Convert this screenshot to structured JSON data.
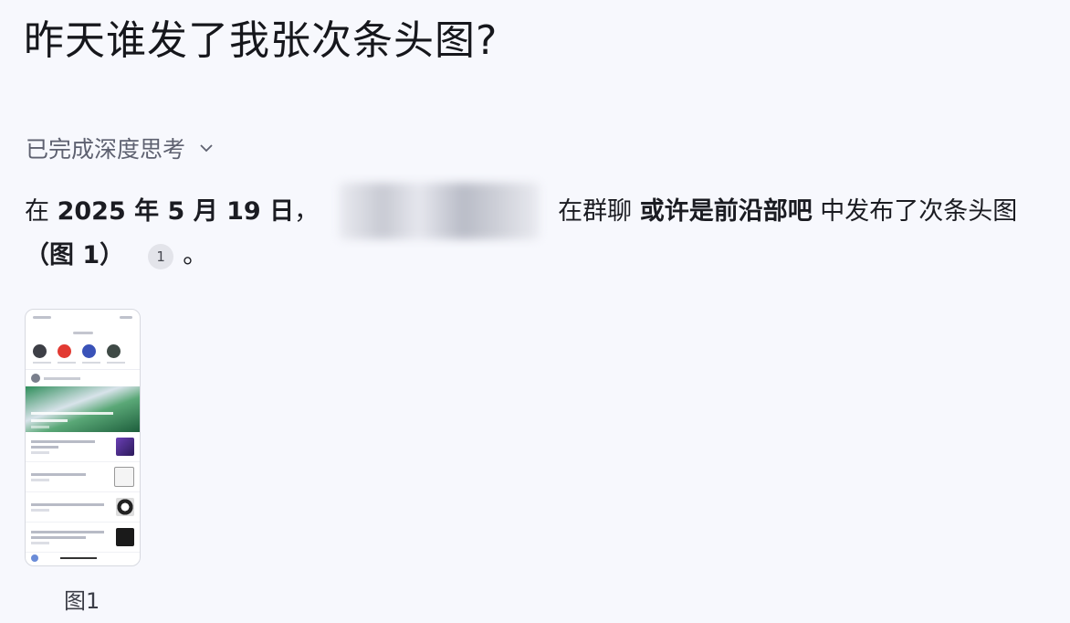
{
  "question": "昨天谁发了我张次条头图?",
  "thinking": {
    "label": "已完成深度思考"
  },
  "answer": {
    "p1": "在 ",
    "date": "2025 年 5 月 19 日",
    "p2": "，",
    "p3": "在群聊 ",
    "group": "或许是前沿部吧",
    "p4": " 中发布了次条头图 ",
    "figref": "（图 1）",
    "citation": "1",
    "end": "。"
  },
  "figure": {
    "caption": "图1"
  }
}
